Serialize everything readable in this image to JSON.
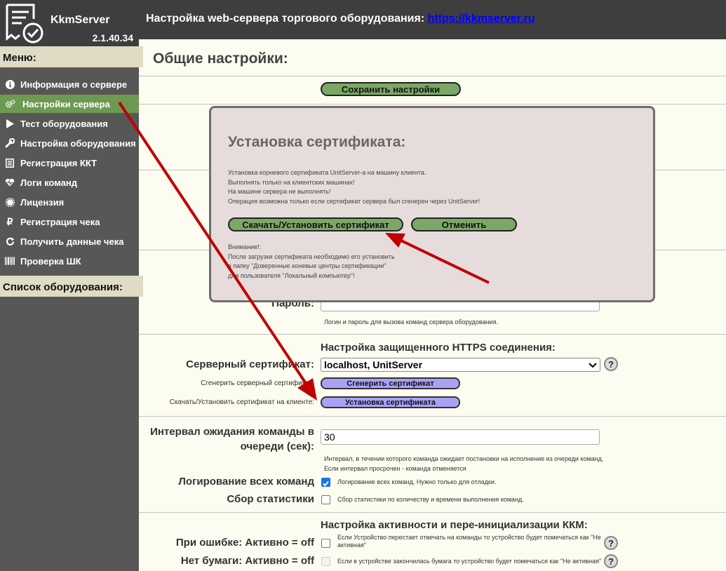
{
  "app": {
    "name": "KkmServer",
    "version": "2.1.40.34"
  },
  "header": {
    "title": "Настройка web-сервера торгового оборудования: ",
    "link": "https://kkmserver.ru"
  },
  "sidebar": {
    "menu_title": "Меню:",
    "items": [
      {
        "label": "Информация о сервере",
        "icon": "info-icon"
      },
      {
        "label": "Настройки сервера",
        "icon": "cogs-icon",
        "active": true
      },
      {
        "label": "Тест оборудования",
        "icon": "play-icon"
      },
      {
        "label": "Настройка оборудования",
        "icon": "wrench-icon"
      },
      {
        "label": "Регистрация ККТ",
        "icon": "list-icon"
      },
      {
        "label": "Логи команд",
        "icon": "heartbeat-icon"
      },
      {
        "label": "Лицензия",
        "icon": "certificate-icon"
      },
      {
        "label": "Регистрация чека",
        "icon": "ruble-icon"
      },
      {
        "label": "Получить данные чека",
        "icon": "refresh-icon"
      },
      {
        "label": "Проверка ШК",
        "icon": "barcode-icon"
      }
    ],
    "equipment_title": "Список оборудования:"
  },
  "main": {
    "title": "Общие настройки:",
    "save_button": "Сохранить настройки",
    "password_label": "Пароль:",
    "password_hint": "Логин и пароль для вызова команд сервера оборудования.",
    "https_title": "Настройка защищенного HTTPS соединения:",
    "server_cert_label": "Серверный сертификат:",
    "server_cert_value": "localhost, UnitServer",
    "generate_label": "Сгенерить серверный сертификат:",
    "generate_button": "Сгенерить сертификат",
    "install_label": "Скачать/Установить сертификат на клиенте:",
    "install_button": "Установка сертификата",
    "interval_label_line1": "Интервал ожидания команды в",
    "interval_label_line2": "очереди (сек):",
    "interval_value": "30",
    "interval_hint_line1": "Интервал, в течении которого команда ожидает постановки на исполнение из очереди команд.",
    "interval_hint_line2": "Если интервал просрочен - команда отменяется",
    "logging_label": "Логирование всех команд",
    "logging_hint": "Логирование всех команд. Нужно только для отладки.",
    "logging_checked": true,
    "stats_label": "Сбор статистики",
    "stats_hint": "Сбор статистики по количеству и времени выполнения команд.",
    "stats_checked": false,
    "kkm_title": "Настройка активности и пере-инициализации ККМ:",
    "on_error_label": "При ошибке: Активно = off",
    "on_error_hint_line1": "Если Устройство перестает отвечать на команды то устройство будет помечаться как \"Не",
    "on_error_hint_line2": "активная\"",
    "no_paper_label": "Нет бумаги: Активно = off",
    "no_paper_hint": "Если в устройстве закончилась бумага то устройство будет помечаться как \"Не активная\"",
    "help_symbol": "?"
  },
  "modal": {
    "title": "Установка сертификата:",
    "line1": "Установка корневого сертификата UnitServer-а на машину клиента.",
    "line2": "Выполнять только на клиентских машинах!",
    "line3": "На машине сервера не выполнять!",
    "line4": "Операция возможна только если сертификат сервера был сгенерен через UnitServer!",
    "download_button": "Скачать/Установить сертификат",
    "cancel_button": "Отменить",
    "note1": "Внимание!:",
    "note2": "После загрузки сертификата необходимо его установить",
    "note3": "в папку \"Доверенные коневые центры сертификации\"",
    "note4": "для пользователя \"Локальный компьютер\"!"
  },
  "colors": {
    "accent": "#6D9A52",
    "sidebar": "#575757",
    "header": "#3E3E3E",
    "button_green": "#7BA866",
    "button_purple": "#A8A2F7",
    "arrow": "#C00000"
  }
}
